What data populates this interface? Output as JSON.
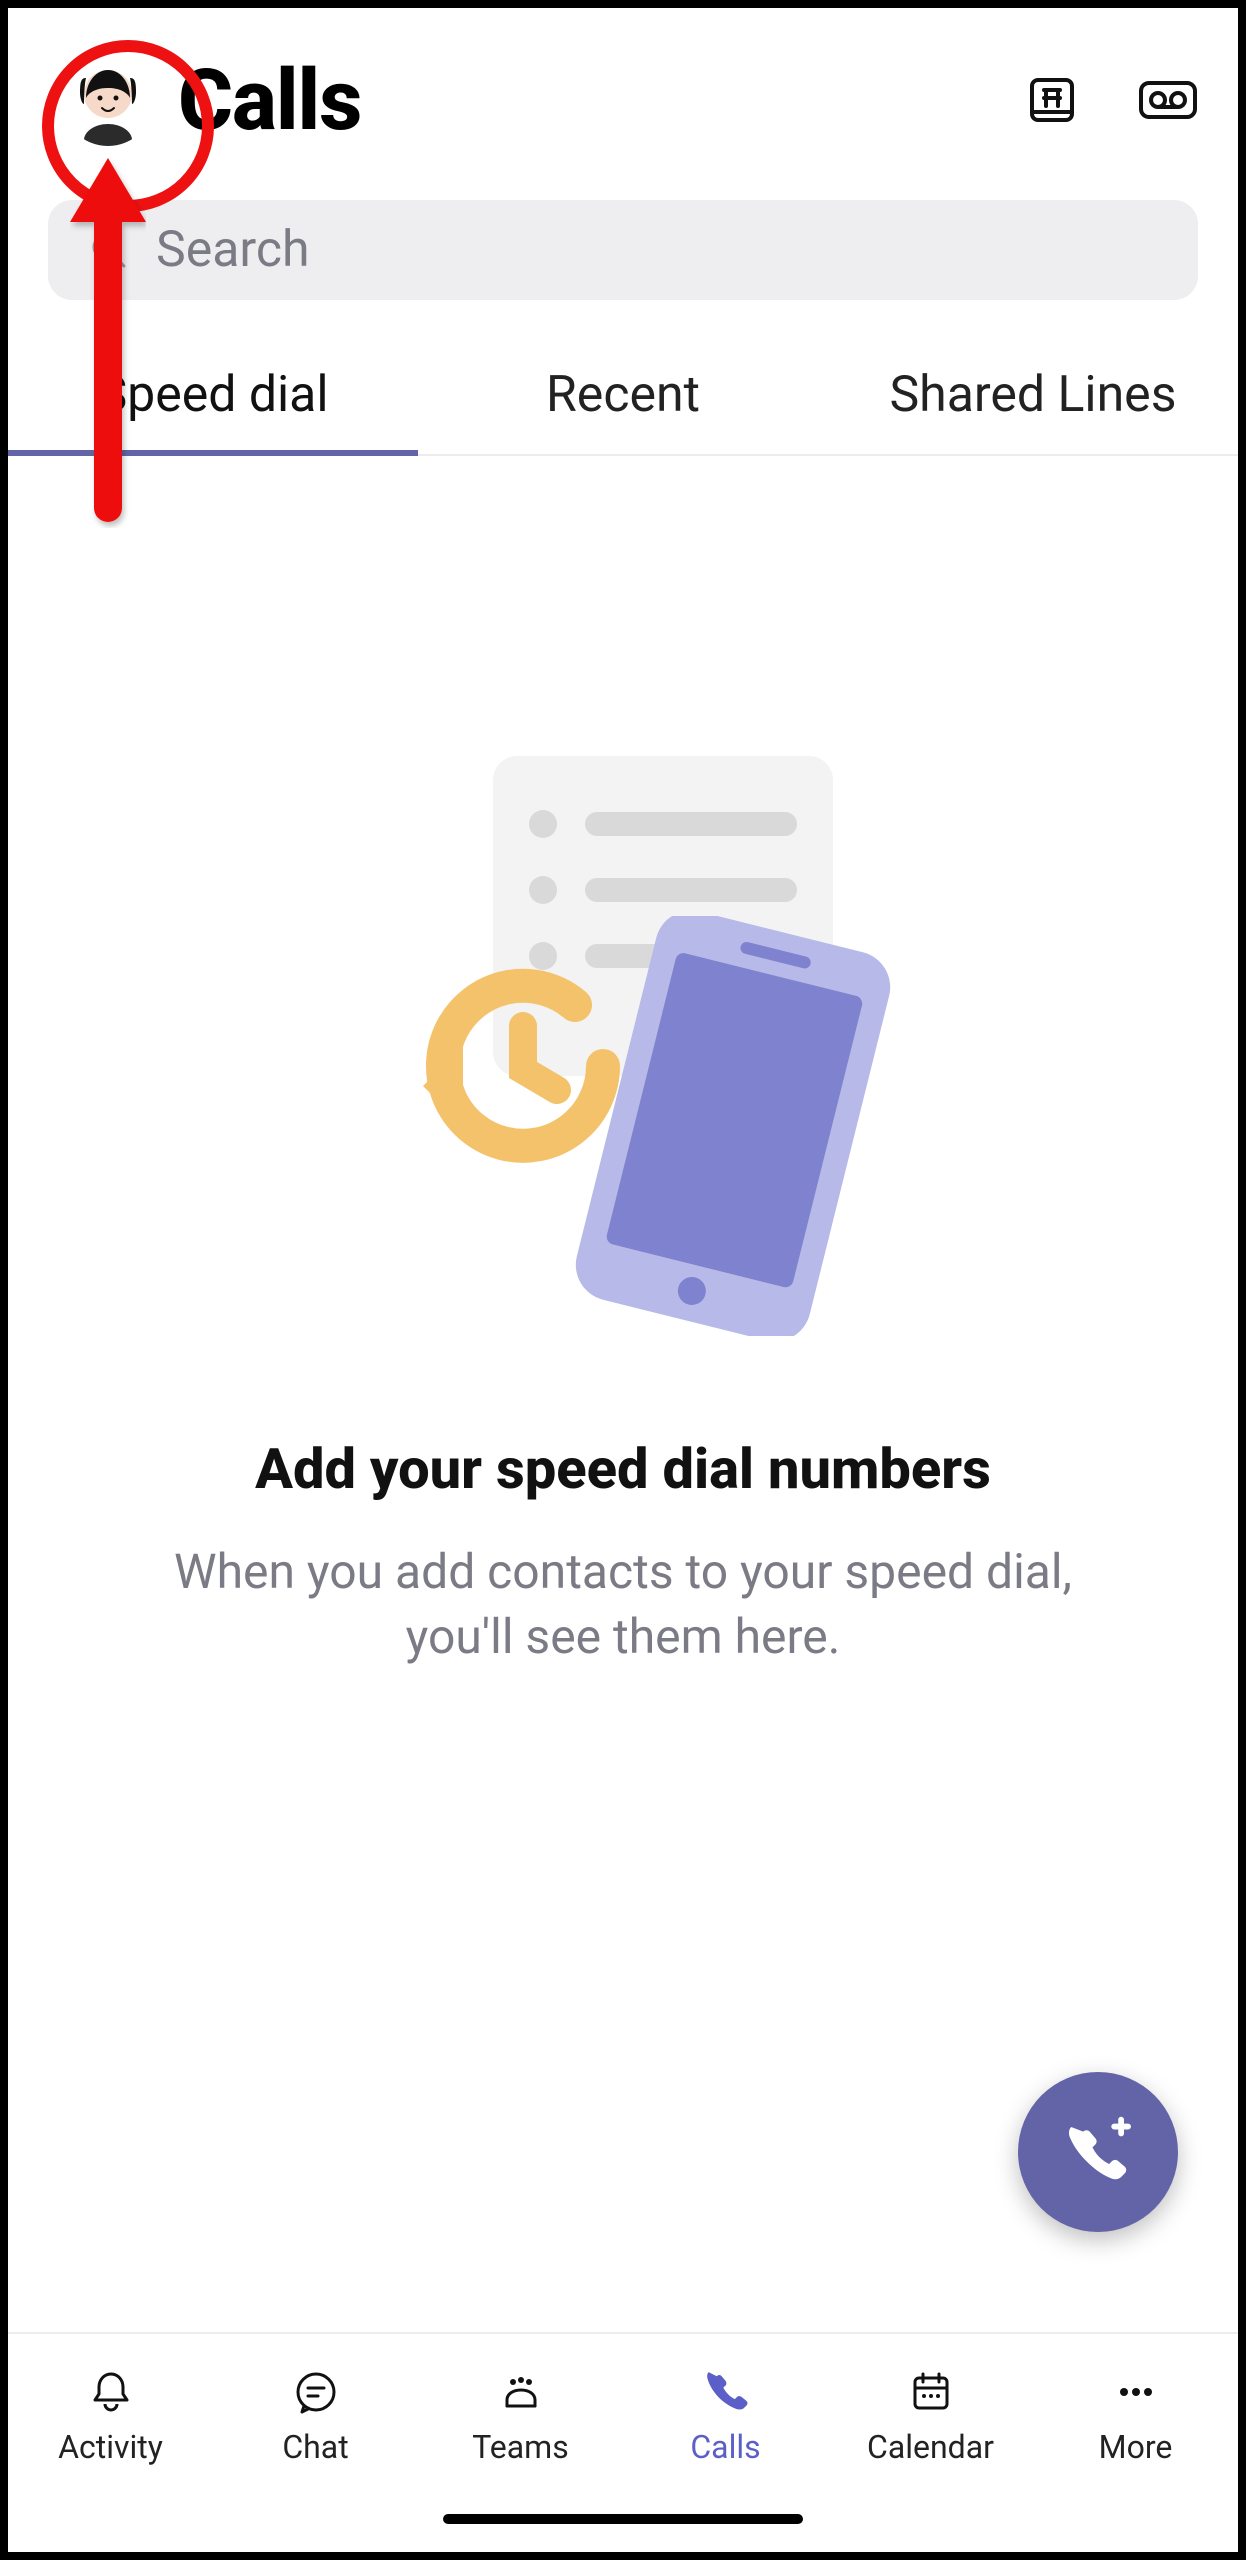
{
  "header": {
    "title": "Calls"
  },
  "search": {
    "placeholder": "Search"
  },
  "tabs": {
    "items": [
      {
        "label": "Speed dial"
      },
      {
        "label": "Recent"
      },
      {
        "label": "Shared Lines"
      }
    ],
    "activeIndex": 0
  },
  "empty": {
    "title": "Add your speed dial numbers",
    "subtitle": "When you add contacts to your speed dial, you'll see them here."
  },
  "tabbar": {
    "items": [
      {
        "label": "Activity"
      },
      {
        "label": "Chat"
      },
      {
        "label": "Teams"
      },
      {
        "label": "Calls"
      },
      {
        "label": "Calendar"
      },
      {
        "label": "More"
      }
    ],
    "activeIndex": 3
  },
  "colors": {
    "accent": "#6264a7",
    "accentTabbar": "#5b5fc7",
    "annotation": "#e11"
  }
}
